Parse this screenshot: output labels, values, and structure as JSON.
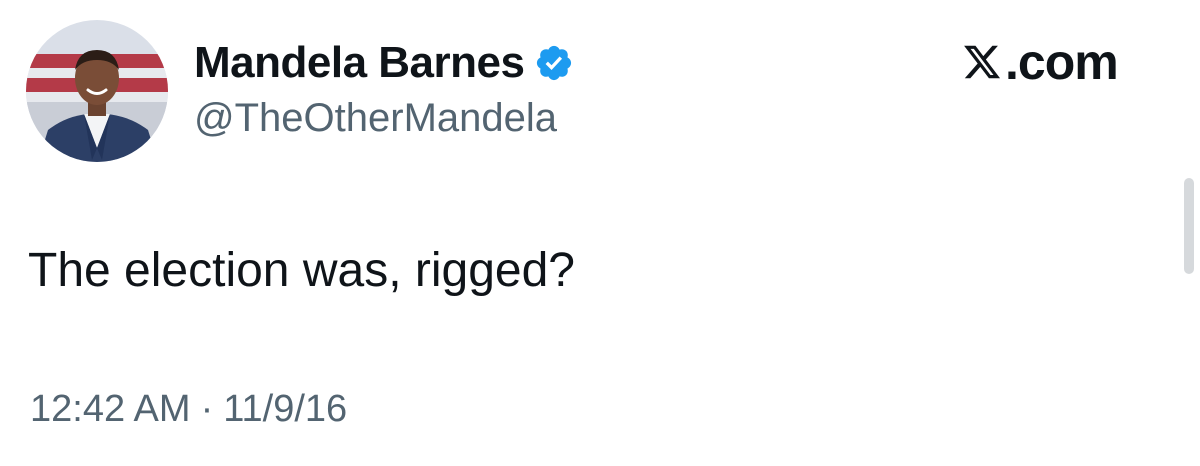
{
  "author": {
    "display_name": "Mandela Barnes",
    "handle": "@TheOtherMandela",
    "verified_icon": "verified-badge-icon"
  },
  "brand": {
    "logo_icon": "x-logo-icon",
    "text": ".com"
  },
  "tweet": {
    "text": "The election was, rigged?",
    "time": "12:42 AM",
    "separator": "·",
    "date": "11/9/16"
  },
  "colors": {
    "text_primary": "#0f1419",
    "text_secondary": "#536471",
    "verified_blue": "#1d9bf0",
    "background": "#ffffff"
  }
}
